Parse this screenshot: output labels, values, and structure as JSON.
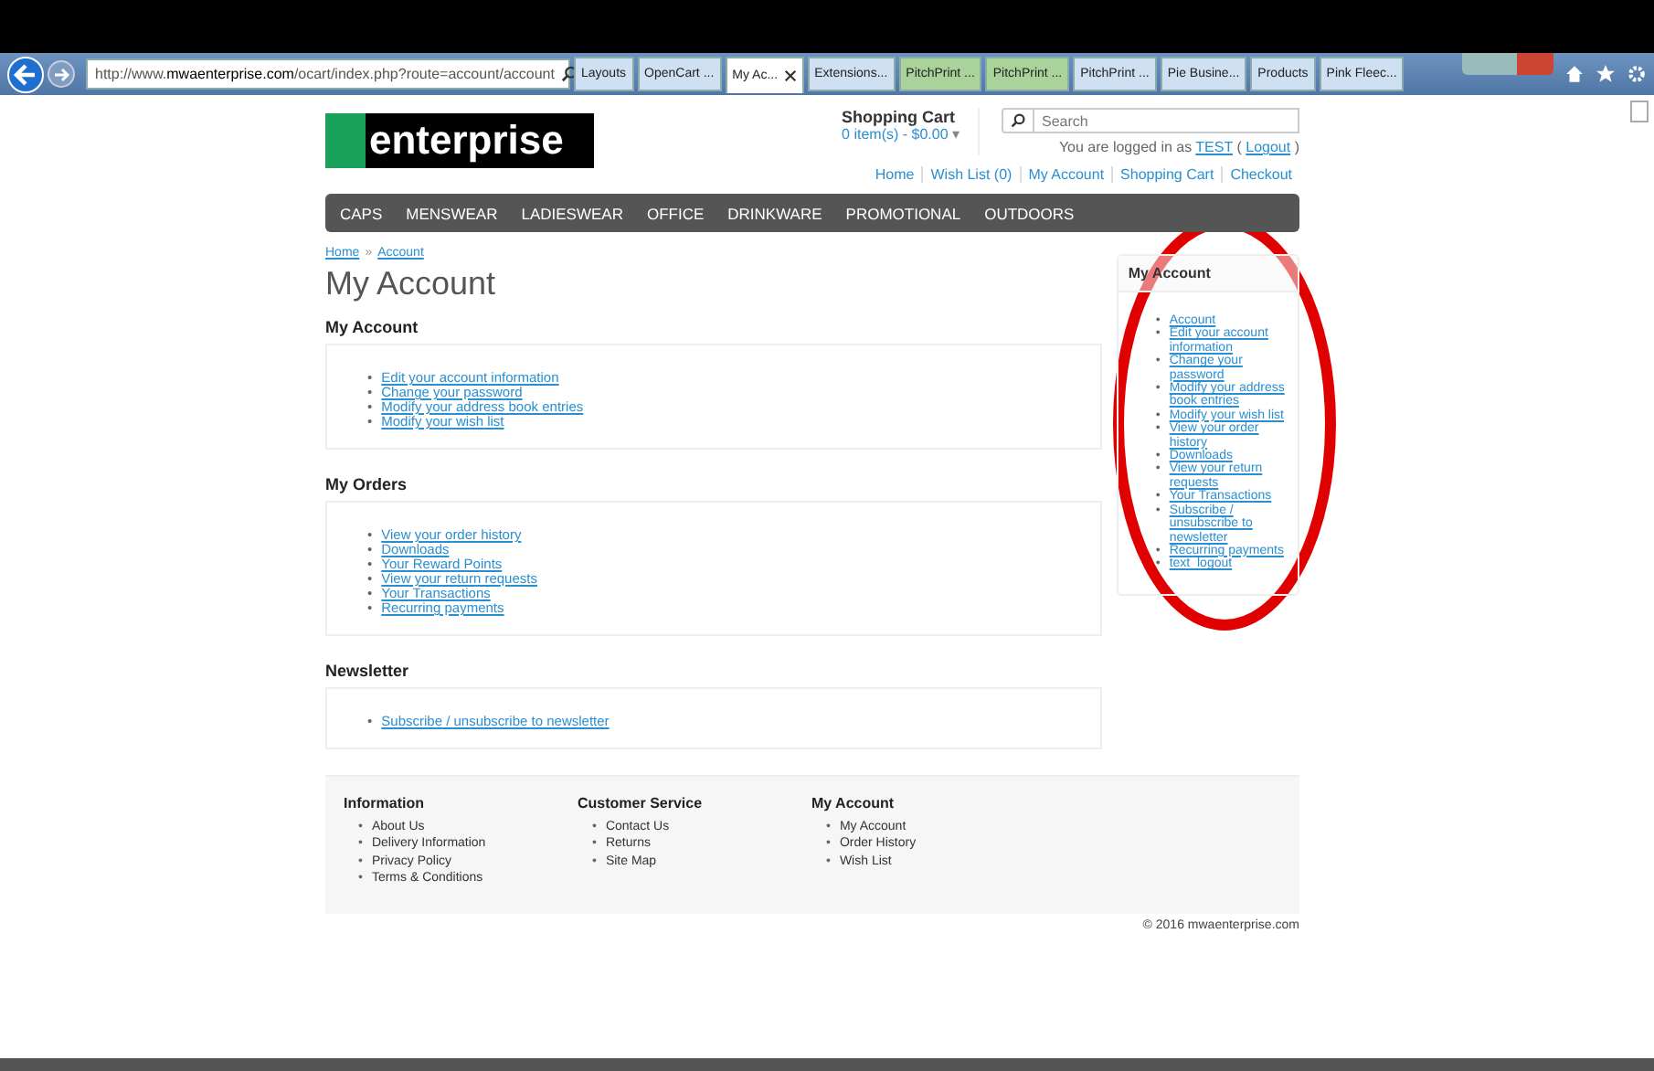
{
  "browser": {
    "address": {
      "prefix": "http://www.",
      "domain": "mwaenterprise.com",
      "path": "/ocart/index.php?route=account/account"
    },
    "tabs": [
      {
        "label": "Layouts",
        "selected": false,
        "color": "#cfe0f2"
      },
      {
        "label": "OpenCart ...",
        "selected": false,
        "color": "#cfe0f2"
      },
      {
        "label": "My Ac...",
        "selected": true,
        "color": "#ffffff"
      },
      {
        "label": "Extensions...",
        "selected": false,
        "color": "#cfe0f2"
      },
      {
        "label": "PitchPrint ...",
        "selected": false,
        "color": "#a9d39a"
      },
      {
        "label": "PitchPrint ...",
        "selected": false,
        "color": "#a9d39a"
      },
      {
        "label": "PitchPrint ...",
        "selected": false,
        "color": "#cfe0f2"
      },
      {
        "label": "Pie Busine...",
        "selected": false,
        "color": "#cfe0f2"
      },
      {
        "label": "Products",
        "selected": false,
        "color": "#cfe0f2"
      },
      {
        "label": "Pink Fleec...",
        "selected": false,
        "color": "#cfe0f2"
      }
    ]
  },
  "header": {
    "logo": "enterprise",
    "cart_title": "Shopping Cart",
    "cart_summary": "0 item(s) - $0.00",
    "cart_caret": "▾",
    "search": {
      "placeholder": "Search"
    },
    "login_prefix": "You are logged in as",
    "login_user": "TEST",
    "login_open": "(",
    "logout": "Logout",
    "login_close": ")",
    "links": [
      "Home",
      "Wish List (0)",
      "My Account",
      "Shopping Cart",
      "Checkout"
    ]
  },
  "menu": [
    "CAPS",
    "MENSWEAR",
    "LADIESWEAR",
    "OFFICE",
    "DRINKWARE",
    "PROMOTIONAL",
    "OUTDOORS"
  ],
  "breadcrumb": [
    "Home",
    "Account"
  ],
  "breadcrumb_separator": "»",
  "title": "My Account",
  "sections": [
    {
      "heading": "My Account",
      "marker": "•",
      "links": [
        "Edit your account information",
        "Change your password",
        "Modify your address book entries",
        "Modify your wish list"
      ]
    },
    {
      "heading": "My Orders",
      "marker": "•",
      "links": [
        "View your order history",
        "Downloads",
        "Your Reward Points",
        "View your return requests",
        "Your Transactions",
        "Recurring payments"
      ]
    },
    {
      "heading": "Newsletter",
      "marker": "•",
      "links": [
        "Subscribe / unsubscribe to newsletter"
      ]
    }
  ],
  "sidebar": {
    "heading": "My Account",
    "marker": "•",
    "links": [
      "Account",
      "Edit your account information",
      "Change your password",
      "Modify your address book entries",
      "Modify your wish list",
      "View your order history",
      "Downloads",
      "View your return requests",
      "Your Transactions",
      "Subscribe / unsubscribe to newsletter",
      "Recurring payments",
      "text_logout"
    ]
  },
  "footer": {
    "columns": [
      {
        "heading": "Information",
        "marker": "•",
        "links": [
          "About Us",
          "Delivery Information",
          "Privacy Policy",
          "Terms & Conditions"
        ]
      },
      {
        "heading": "Customer Service",
        "marker": "•",
        "links": [
          "Contact Us",
          "Returns",
          "Site Map"
        ]
      },
      {
        "heading": "My Account",
        "marker": "•",
        "links": [
          "My Account",
          "Order History",
          "Wish List"
        ]
      }
    ],
    "copyright": "© 2016 mwaenterprise.com"
  }
}
